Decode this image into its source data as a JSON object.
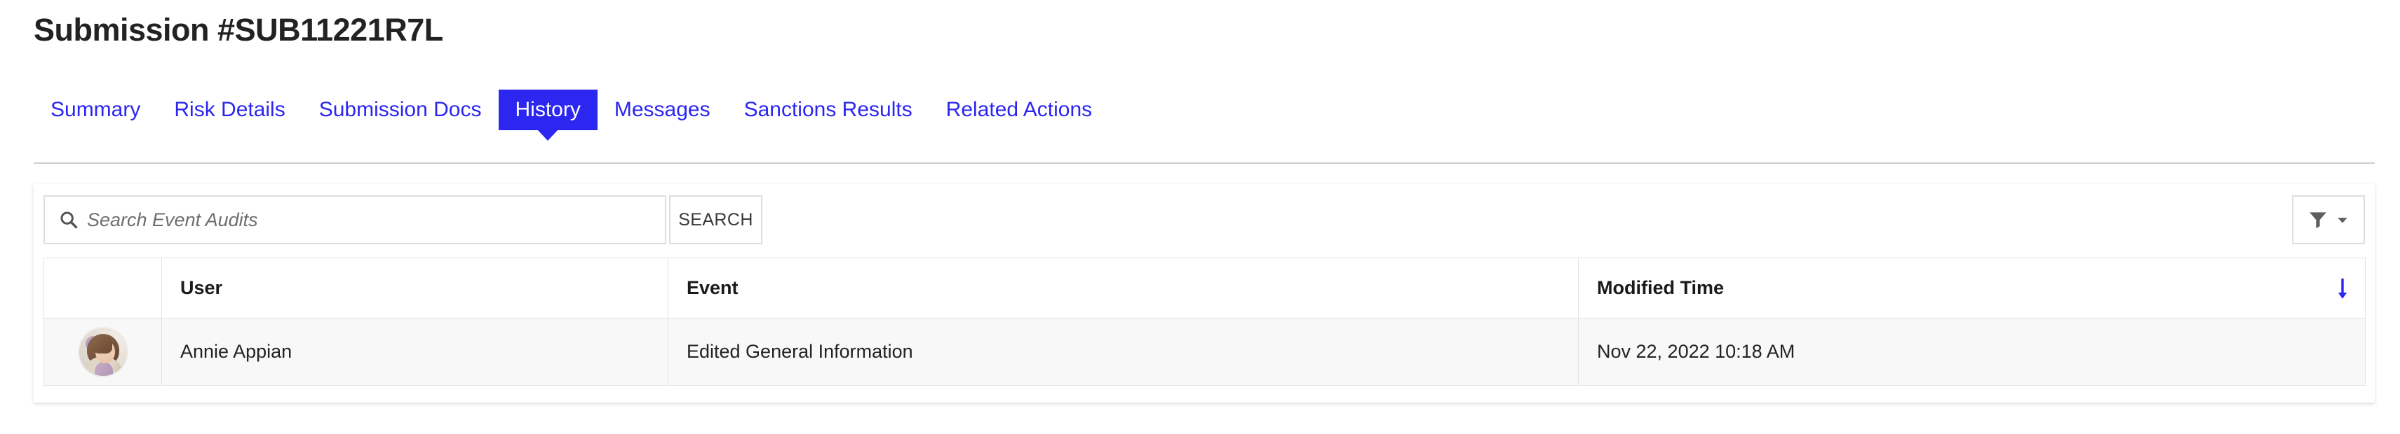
{
  "header": {
    "title": "Submission #SUB11221R7L"
  },
  "colors": {
    "accent_blue": "#2B26F0",
    "active_tab_bg": "#2B26F0",
    "active_tab_text": "#FFFFFF",
    "border_gray": "#DEDEDE",
    "row_bg": "#F8F8F8",
    "text_dark": "#222222",
    "sort_arrow": "#2B26F0"
  },
  "tabs": [
    {
      "label": "Summary",
      "active": false
    },
    {
      "label": "Risk Details",
      "active": false
    },
    {
      "label": "Submission Docs",
      "active": false
    },
    {
      "label": "History",
      "active": true
    },
    {
      "label": "Messages",
      "active": false
    },
    {
      "label": "Sanctions Results",
      "active": false
    },
    {
      "label": "Related Actions",
      "active": false
    }
  ],
  "toolbar": {
    "search_placeholder": "Search Event Audits",
    "search_value": "",
    "search_icon": "search-icon",
    "search_button_label": "SEARCH",
    "filter_icon": "funnel-icon",
    "filter_caret_icon": "chevron-down-icon"
  },
  "table": {
    "columns": [
      {
        "key": "avatar",
        "label": ""
      },
      {
        "key": "user",
        "label": "User"
      },
      {
        "key": "event",
        "label": "Event"
      },
      {
        "key": "time",
        "label": "Modified Time"
      }
    ],
    "sort": {
      "column": "Modified Time",
      "direction": "descending",
      "icon": "arrow-down-icon"
    },
    "rows": [
      {
        "avatar_alt": "Annie Appian profile photo",
        "user": "Annie Appian",
        "event": "Edited General Information",
        "time": "Nov 22, 2022 10:18 AM"
      }
    ]
  }
}
